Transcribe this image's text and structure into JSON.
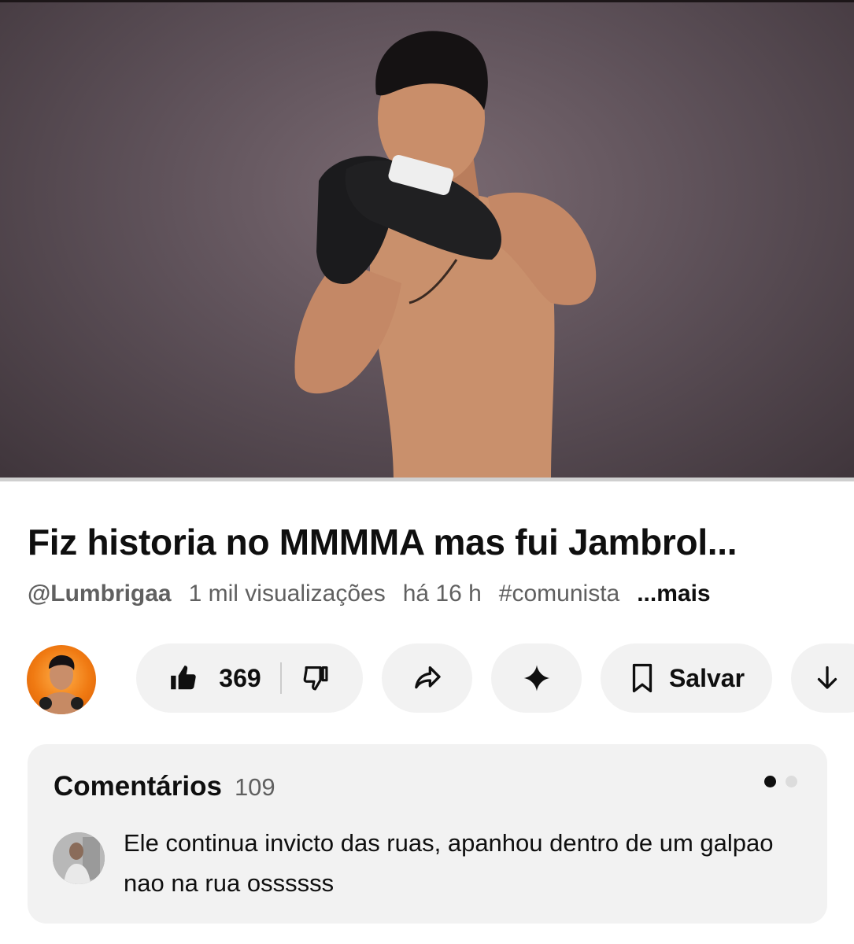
{
  "video": {
    "progress": 0
  },
  "title": "Fiz historia no MMMMA mas fui Jambrol...",
  "meta": {
    "channel": "@Lumbrigaa",
    "views": "1 mil visualizações",
    "age": "há 16 h",
    "hashtag": "#comunista",
    "more": "...mais"
  },
  "actions": {
    "like_count": "369",
    "save_label": "Salvar"
  },
  "comments": {
    "label": "Comentários",
    "count": "109",
    "top_comment": "Ele continua invicto das ruas, apanhou dentro de um galpao nao na rua ossssss"
  },
  "icons": {
    "like": "thumbs-up-icon",
    "dislike": "thumbs-down-icon",
    "share": "share-icon",
    "ai": "sparkle-icon",
    "save": "bookmark-icon",
    "download": "download-icon"
  },
  "colors": {
    "pill_bg": "#f2f2f2",
    "text": "#0f0f0f",
    "secondary_text": "#606060",
    "avatar_orange": "#f07a12"
  }
}
